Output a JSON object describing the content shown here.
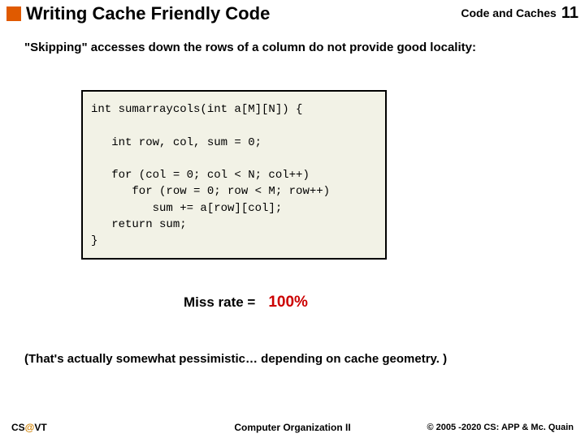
{
  "header": {
    "title": "Writing Cache Friendly Code",
    "topic": "Code and Caches",
    "page": "11"
  },
  "content": {
    "lead": "\"Skipping\" accesses down the rows of a column do not provide good locality:",
    "code": "int sumarraycols(int a[M][N]) {\n\n   int row, col, sum = 0;\n\n   for (col = 0; col < N; col++)\n      for (row = 0; row < M; row++)\n         sum += a[row][col];\n   return sum;\n}",
    "miss_label": "Miss rate =",
    "miss_value": "100%",
    "note": "(That's actually somewhat pessimistic… depending on cache geometry. )"
  },
  "footer": {
    "left_prefix": "CS",
    "left_at": "@",
    "left_suffix": "VT",
    "center": "Computer Organization II",
    "right": "© 2005 -2020 CS: APP & Mc. Quain"
  }
}
